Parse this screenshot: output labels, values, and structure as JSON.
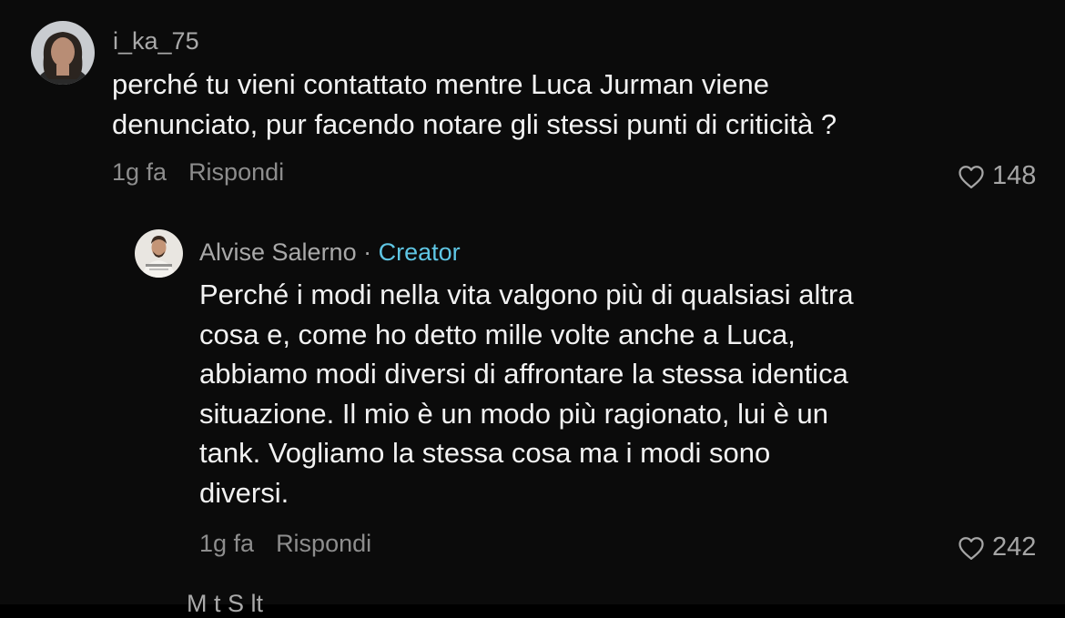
{
  "comments": [
    {
      "username": "i_ka_75",
      "text_lines": [
        "perché tu vieni contattato mentre Luca Jurman viene",
        "denunciato, pur facendo notare gli stessi punti di criticità ?"
      ],
      "time": "1g fa",
      "reply_label": "Rispondi",
      "likes": "148",
      "heart_icon": "heart-outline-icon"
    }
  ],
  "reply": {
    "username": "Alvise Salerno",
    "separator": "·",
    "badge": "Creator",
    "badge_color": "#5fc6e4",
    "text_lines": [
      "Perché i modi nella vita valgono più di qualsiasi altra",
      "cosa e, come ho detto mille volte anche a Luca,",
      "abbiamo modi diversi di affrontare la stessa identica",
      "situazione. Il mio è un modo più ragionato, lui è un",
      "tank. Vogliamo la stessa cosa ma i modi sono",
      "diversi."
    ],
    "time": "1g fa",
    "reply_label": "Rispondi",
    "likes": "242",
    "heart_icon": "heart-outline-icon"
  },
  "next_comment": {
    "username_partial": "M   t   S  lt"
  },
  "colors": {
    "background": "#0b0b0b",
    "text": "#f2f2f2",
    "muted": "#8d8d8d",
    "creator": "#5fc6e4"
  }
}
